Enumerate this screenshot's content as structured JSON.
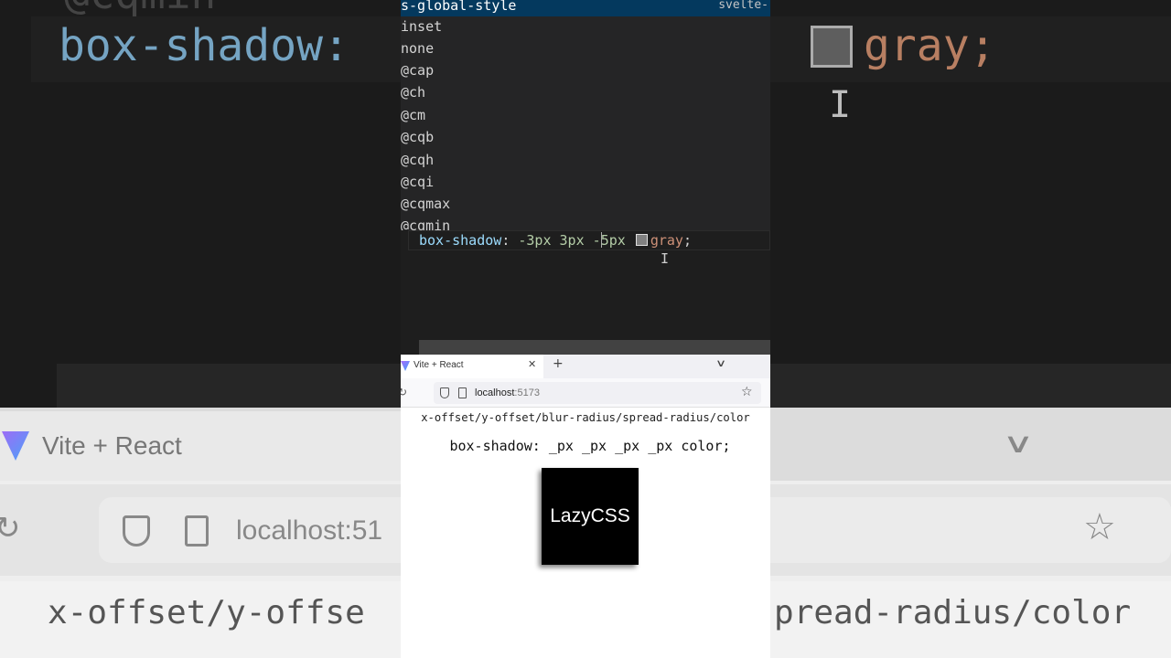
{
  "background": {
    "code_left": "box-shadow:",
    "code_right": "gray;",
    "top_fragment": "@cqmin",
    "tab_title": "Vite + React",
    "url_partial": "localhost:51",
    "content_left": "x-offset/y-offse",
    "content_right": "pread-radius/color"
  },
  "suggestions": [
    {
      "label": "s-global-style",
      "detail": "svelte-",
      "selected": true
    },
    {
      "label": "inset"
    },
    {
      "label": "none"
    },
    {
      "label": "@cap"
    },
    {
      "label": "@ch"
    },
    {
      "label": "@cm"
    },
    {
      "label": "@cqb"
    },
    {
      "label": "@cqh"
    },
    {
      "label": "@cqi"
    },
    {
      "label": "@cqmax"
    },
    {
      "label": "@cqmin"
    }
  ],
  "editor": {
    "property": "box-shadow",
    "colon": ": ",
    "v1": "-3px",
    "v2": "3px",
    "v3_before_caret": "-",
    "v3_after_caret": "5px",
    "color_value": "gray",
    "semicolon": ";",
    "swatch_color": "#808080"
  },
  "browser": {
    "tab_title": "Vite + React",
    "close_glyph": "✕",
    "new_tab_glyph": "+",
    "menu_glyph": "∨",
    "reload_glyph": "↻",
    "host": "localhost",
    "port": ":5173",
    "star_glyph": "☆",
    "line1": "x-offset/y-offset/blur-radius/spread-radius/color",
    "line2": "box-shadow: _px _px _px _px color;",
    "box_label": "LazyCSS"
  },
  "colors": {
    "suggest_selected_bg": "#04395e",
    "editor_bg": "#1e1e1e",
    "css_property": "#9cdcfe",
    "css_number": "#b5cea8",
    "css_value": "#ce9178"
  }
}
